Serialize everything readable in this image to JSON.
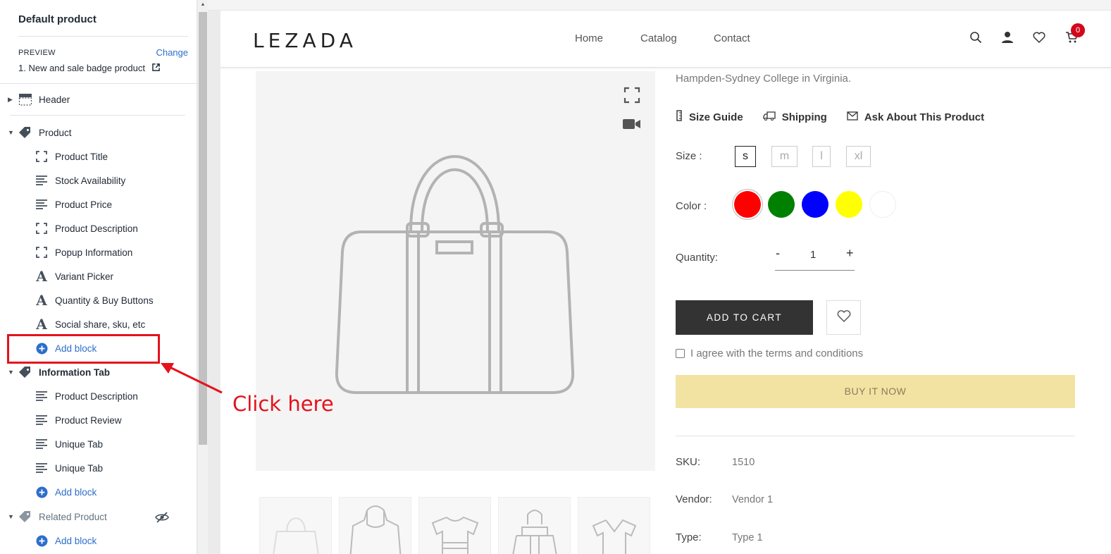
{
  "sidebar": {
    "title": "Default product",
    "preview_label": "PREVIEW",
    "change_label": "Change",
    "preview_value": "1. New and sale badge product",
    "sections": {
      "header": "Header",
      "product": "Product",
      "information_tab": "Information Tab",
      "related_product": "Related Product"
    },
    "product_blocks": [
      {
        "label": "Product Title",
        "icon": "dashed-frame-icon"
      },
      {
        "label": "Stock Availability",
        "icon": "text-lines-icon"
      },
      {
        "label": "Product Price",
        "icon": "text-lines-icon"
      },
      {
        "label": "Product Description",
        "icon": "dashed-frame-icon"
      },
      {
        "label": "Popup Information",
        "icon": "dashed-frame-icon"
      },
      {
        "label": "Variant Picker",
        "icon": "font-a-icon"
      },
      {
        "label": "Quantity & Buy Buttons",
        "icon": "font-a-icon"
      },
      {
        "label": "Social share, sku, etc",
        "icon": "font-a-icon"
      }
    ],
    "info_blocks": [
      {
        "label": "Product Description",
        "icon": "text-lines-icon"
      },
      {
        "label": "Product Review",
        "icon": "text-lines-icon"
      },
      {
        "label": "Unique Tab",
        "icon": "text-lines-icon"
      },
      {
        "label": "Unique Tab",
        "icon": "text-lines-icon"
      }
    ],
    "add_block": "Add block"
  },
  "annotation": {
    "text": "Click here",
    "color": "#e5121c"
  },
  "store": {
    "logo": "LEZADA",
    "nav": [
      "Home",
      "Catalog",
      "Contact"
    ],
    "cart_count": "0",
    "accent": "#d2071b"
  },
  "product": {
    "desc_tail": "Hampden-Sydney College in Virginia.",
    "links": [
      "Size Guide",
      "Shipping",
      "Ask About This Product"
    ],
    "size_label": "Size :",
    "sizes": [
      "s",
      "m",
      "l",
      "xl"
    ],
    "selected_size": "s",
    "color_label": "Color :",
    "colors": [
      "#ff0000",
      "#008000",
      "#0000ff",
      "#ffff00",
      "#ffffff"
    ],
    "quantity_label": "Quantity:",
    "quantity_minus": "-",
    "quantity_value": "1",
    "quantity_plus": "+",
    "add_to_cart": "ADD TO CART",
    "agree": "I agree with the terms and conditions",
    "buy_now": "BUY IT NOW",
    "meta": {
      "sku_label": "SKU:",
      "sku": "1510",
      "vendor_label": "Vendor:",
      "vendor": "Vendor 1",
      "type_label": "Type:",
      "type": "Type 1"
    }
  }
}
